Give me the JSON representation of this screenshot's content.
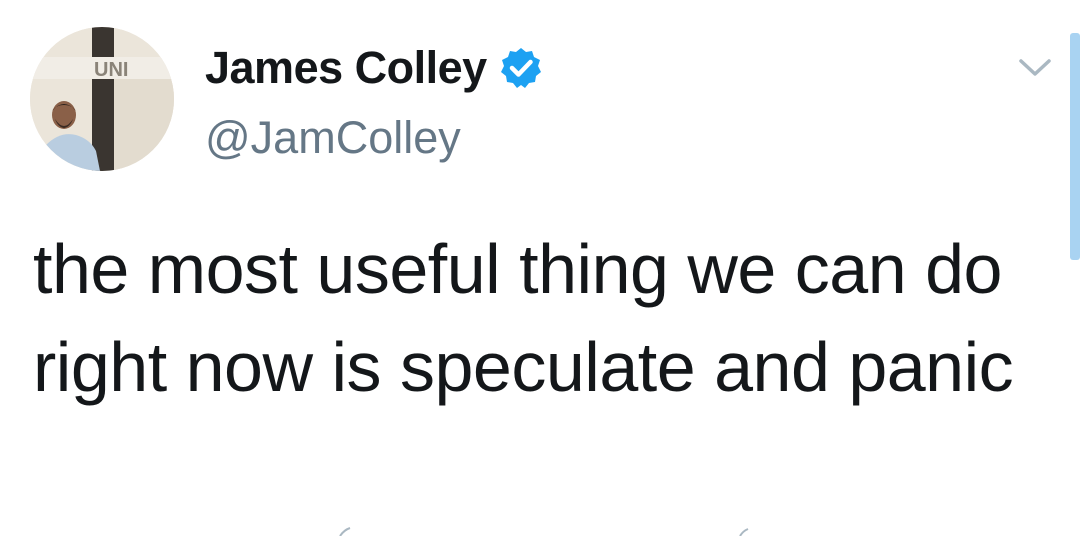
{
  "tweet": {
    "author": {
      "display_name": "James Colley",
      "handle": "@JamColley",
      "verified": true,
      "avatar_icon": "profile-photo",
      "avatar_sign_text": "UNI"
    },
    "text": "the most useful thing we can do right now is speculate and panic",
    "menu_icon": "chevron-down-icon"
  },
  "colors": {
    "text": "#14171a",
    "handle": "#657786",
    "verified_badge": "#1da1f2",
    "caret": "#aab8c2",
    "scrollbar": "#a9d3f2"
  }
}
